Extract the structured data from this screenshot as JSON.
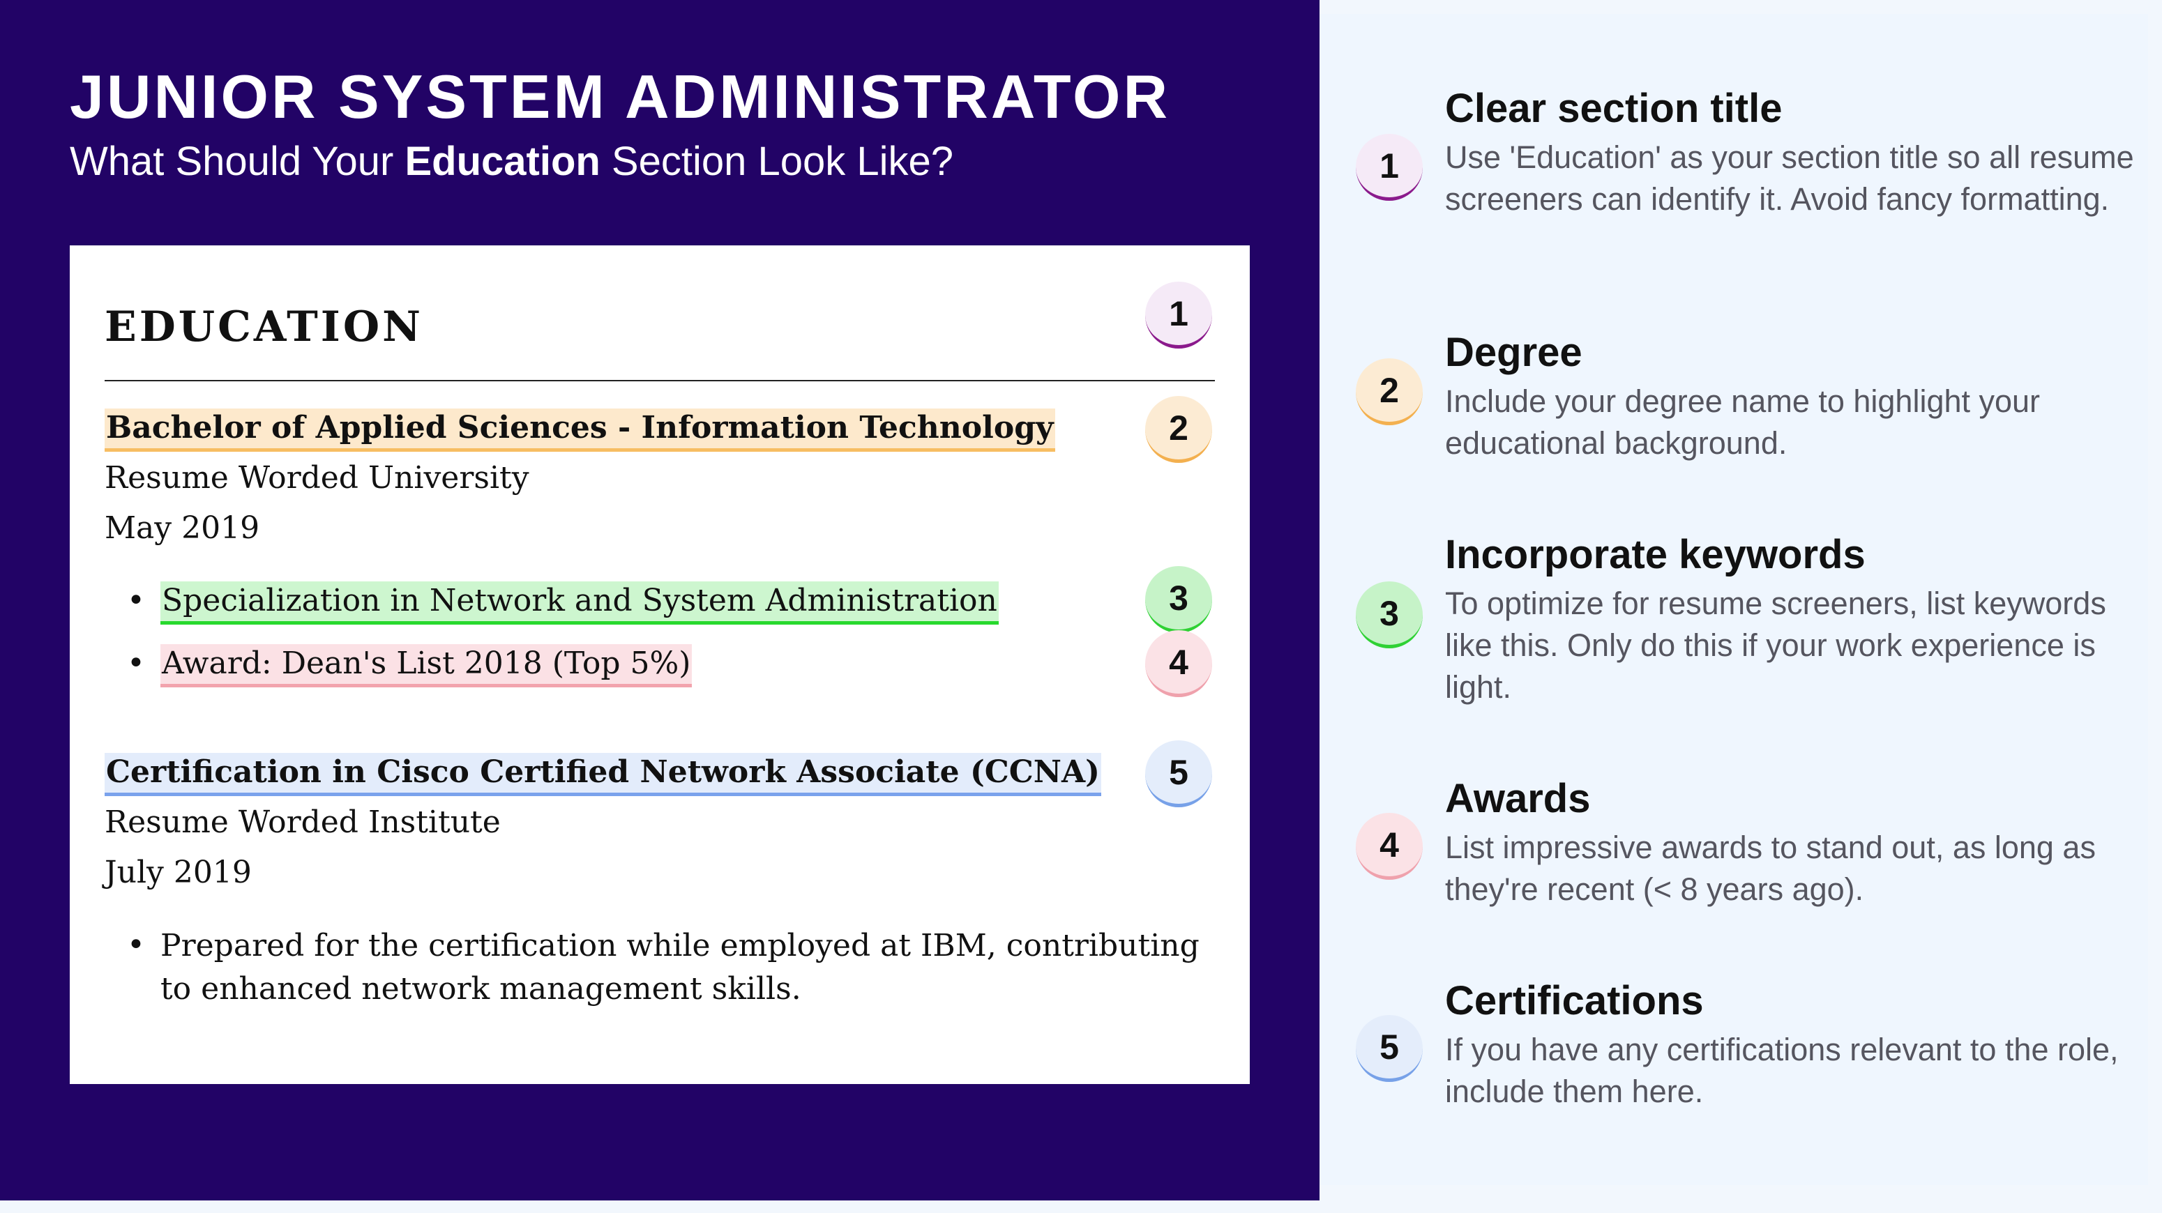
{
  "header": {
    "title": "JUNIOR SYSTEM ADMINISTRATOR",
    "subtitle_prefix": "What Should Your ",
    "subtitle_bold": "Education",
    "subtitle_suffix": " Section Look Like?"
  },
  "resume": {
    "section_title": "EDUCATION",
    "entries": [
      {
        "degree": "Bachelor of Applied Sciences - Information Technology",
        "school": "Resume Worded University",
        "date": "May 2019",
        "bullets": [
          "Specialization in Network and System Administration",
          "Award: Dean's List 2018 (Top 5%)"
        ]
      },
      {
        "degree": "Certification in Cisco Certified Network Associate (CCNA)",
        "school": "Resume Worded Institute",
        "date": "July 2019",
        "bullets": [
          "Prepared for the certification while employed at IBM, contributing to enhanced network management skills."
        ]
      }
    ]
  },
  "markers": [
    "1",
    "2",
    "3",
    "4",
    "5"
  ],
  "tips": [
    {
      "number": "1",
      "title": "Clear section title",
      "body": "Use 'Education' as your section title so all resume screeners can identify it. Avoid fancy formatting."
    },
    {
      "number": "2",
      "title": "Degree",
      "body": "Include your degree name to highlight your educational background."
    },
    {
      "number": "3",
      "title": "Incorporate keywords",
      "body": "To optimize for resume screeners, list keywords like this. Only do this if your work experience is light."
    },
    {
      "number": "4",
      "title": "Awards",
      "body": "List impressive awards to stand out, as long as they're recent (< 8 years ago)."
    },
    {
      "number": "5",
      "title": "Certifications",
      "body": "If you have any certifications relevant to the role, include them here."
    }
  ],
  "colors": {
    "background_dark": "#220366",
    "panel_light": "#eff6fe",
    "marker_1": "#8b1a8c",
    "marker_2": "#f3b04f",
    "marker_3": "#2fd134",
    "marker_4": "#efa1ac",
    "marker_5": "#77a1e8"
  }
}
